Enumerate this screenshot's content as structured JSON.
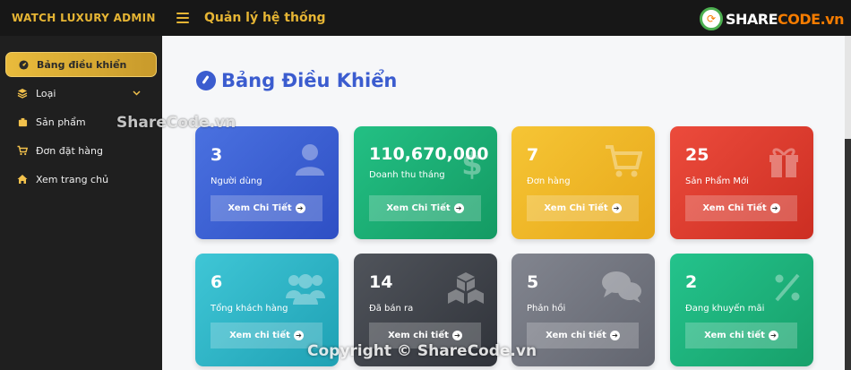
{
  "app": {
    "brand": "WATCH LUXURY ADMIN",
    "header_title": "Quản lý hệ thống",
    "logo": {
      "prefix": "SHARE",
      "suffix": "CODE.vn"
    }
  },
  "sidebar": {
    "items": [
      {
        "label": "Bảng điều khiển",
        "icon": "dashboard-icon",
        "active": true
      },
      {
        "label": "Loại",
        "icon": "layers-icon",
        "has_submenu": true
      },
      {
        "label": "Sản phẩm",
        "icon": "box-icon"
      },
      {
        "label": "Đơn đặt hàng",
        "icon": "cart-icon"
      },
      {
        "label": "Xem trang chủ",
        "icon": "home-icon"
      }
    ]
  },
  "main": {
    "title": "Bảng Điều Khiển"
  },
  "cards": [
    {
      "value": "3",
      "label": "Người dùng",
      "button": "Xem Chi Tiết",
      "icon": "user-icon",
      "color": "#3a5fd6"
    },
    {
      "value": "110,670,000",
      "label": "Doanh thu tháng",
      "button": "Xem Chi Tiết",
      "icon": "dollar-icon",
      "color": "#1caf74"
    },
    {
      "value": "7",
      "label": "Đơn hàng",
      "button": "Xem Chi Tiết",
      "icon": "cart-icon",
      "color": "#f0b828"
    },
    {
      "value": "25",
      "label": "Sản Phẩm Mới",
      "button": "Xem Chi Tiết",
      "icon": "gift-icon",
      "color": "#e03c2e"
    },
    {
      "value": "6",
      "label": "Tổng khách hàng",
      "button": "Xem chi tiết",
      "icon": "users-icon",
      "color": "#2fb4c6"
    },
    {
      "value": "14",
      "label": "Đã bán ra",
      "button": "Xem chi tiết",
      "icon": "cubes-icon",
      "color": "#3d4047"
    },
    {
      "value": "5",
      "label": "Phản hồi",
      "button": "Xem chi tiết",
      "icon": "comments-icon",
      "color": "#71747e"
    },
    {
      "value": "2",
      "label": "Đang khuyến mãi",
      "button": "Xem chi tiết",
      "icon": "percent-icon",
      "color": "#1db27b"
    }
  ],
  "watermarks": {
    "side": "ShareCode.vn",
    "bottom": "Copyright © ShareCode.vn"
  }
}
